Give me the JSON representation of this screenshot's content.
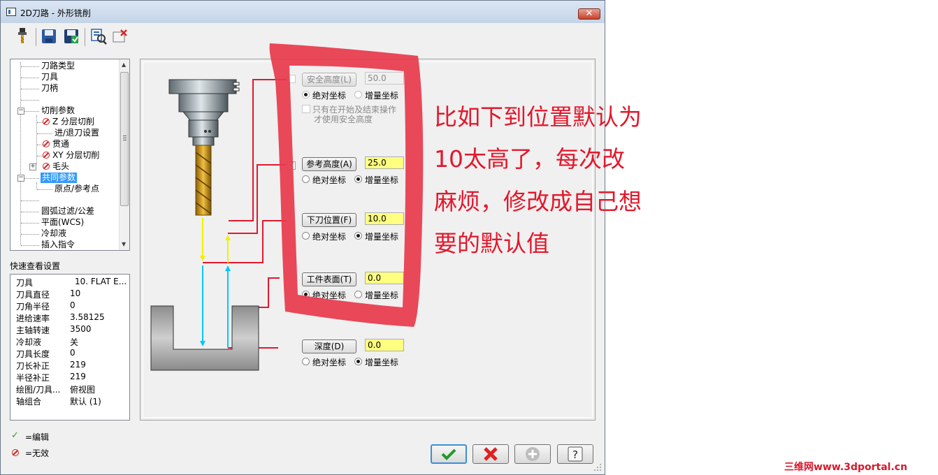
{
  "window": {
    "title": "2D刀路 - 外形铣削",
    "close_label": "✕"
  },
  "toolbar": {
    "icons": [
      "tool-icon",
      "save-icon",
      "save-as-icon",
      "view-icon",
      "delete-icon"
    ]
  },
  "tree": {
    "items": [
      {
        "label": "刀路类型",
        "icon": ""
      },
      {
        "label": "刀具",
        "icon": ""
      },
      {
        "label": "刀柄",
        "icon": ""
      },
      {
        "label": "切削参数",
        "icon": "expander-minus"
      },
      {
        "label": "Z 分层切削",
        "icon": "invalid-icon"
      },
      {
        "label": "进/退刀设置",
        "icon": ""
      },
      {
        "label": "贯通",
        "icon": "invalid-icon"
      },
      {
        "label": "XY 分层切削",
        "icon": "invalid-icon"
      },
      {
        "label": "毛头",
        "icon": "invalid-icon"
      },
      {
        "label": "共同参数",
        "icon": "selected"
      },
      {
        "label": "原点/参考点",
        "icon": ""
      },
      {
        "label": "圆弧过滤/公差",
        "icon": ""
      },
      {
        "label": "平面(WCS)",
        "icon": ""
      },
      {
        "label": "冷却液",
        "icon": ""
      },
      {
        "label": "插入指令",
        "icon": ""
      }
    ]
  },
  "quick_view": {
    "label": "快速查看设置",
    "rows": [
      {
        "key": "刀具",
        "value": "10. FLAT E..."
      },
      {
        "key": "刀具直径",
        "value": "10"
      },
      {
        "key": "刀角半径",
        "value": "0"
      },
      {
        "key": "进给速率",
        "value": "3.58125"
      },
      {
        "key": "主轴转速",
        "value": "3500"
      },
      {
        "key": "冷却液",
        "value": "关"
      },
      {
        "key": "刀具长度",
        "value": "0"
      },
      {
        "key": "刀长补正",
        "value": "219"
      },
      {
        "key": "半径补正",
        "value": "219"
      },
      {
        "key": "绘图/刀具...",
        "value": "俯视图"
      },
      {
        "key": "轴组合",
        "value": "默认 (1)"
      }
    ]
  },
  "legend": {
    "edited": "=编辑",
    "invalid": "=无效"
  },
  "params": {
    "clearance": {
      "label": "安全高度(L)",
      "value": "50.0",
      "abs": "绝对坐标",
      "inc": "增量坐标",
      "enabled": false
    },
    "clearance_option": {
      "line1": "只有在开始及结束操作",
      "line2": "才使用安全高度"
    },
    "retract": {
      "label": "参考高度(A)",
      "value": "25.0",
      "abs": "绝对坐标",
      "inc": "增量坐标"
    },
    "feed_plane": {
      "label": "下刀位置(F)",
      "value": "10.0",
      "abs": "绝对坐标",
      "inc": "增量坐标"
    },
    "top_of_stock": {
      "label": "工件表面(T)",
      "value": "0.0",
      "abs": "绝对坐标",
      "inc": "增量坐标"
    },
    "depth": {
      "label": "深度(D)",
      "value": "0.0",
      "abs": "绝对坐标",
      "inc": "增量坐标"
    }
  },
  "annotation": {
    "lines": [
      "比如下到位置默认为",
      "10太高了，每次改",
      "麻烦，修改成自己想",
      "要的默认值"
    ],
    "color": "#e2182c"
  },
  "bottom_buttons": [
    "ok-button",
    "cancel-button",
    "add-button",
    "help-button"
  ],
  "watermark": "三维网www.3dportal.cn"
}
